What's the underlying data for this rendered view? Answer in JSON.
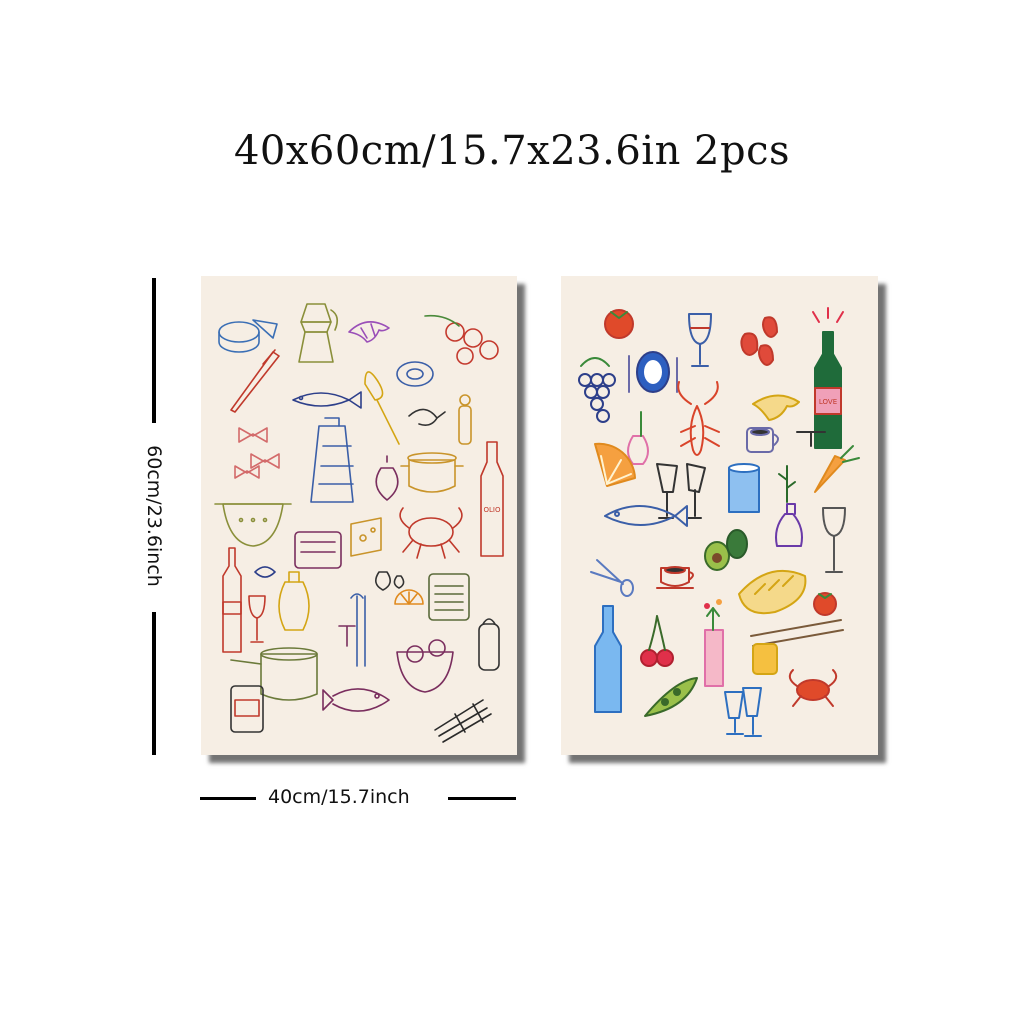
{
  "title": "40x60cm/15.7x23.6in 2pcs",
  "height_label": "60cm/23.6inch",
  "width_label": "40cm/15.7inch",
  "poster_left": {
    "background": "#f6eee4",
    "bottle_label_text": "OLIO"
  },
  "poster_right": {
    "background": "#f6eee4",
    "bottle_label_text": "LOVE"
  },
  "colors": {
    "title_text": "#111111",
    "dimension_lines": "#000000"
  }
}
